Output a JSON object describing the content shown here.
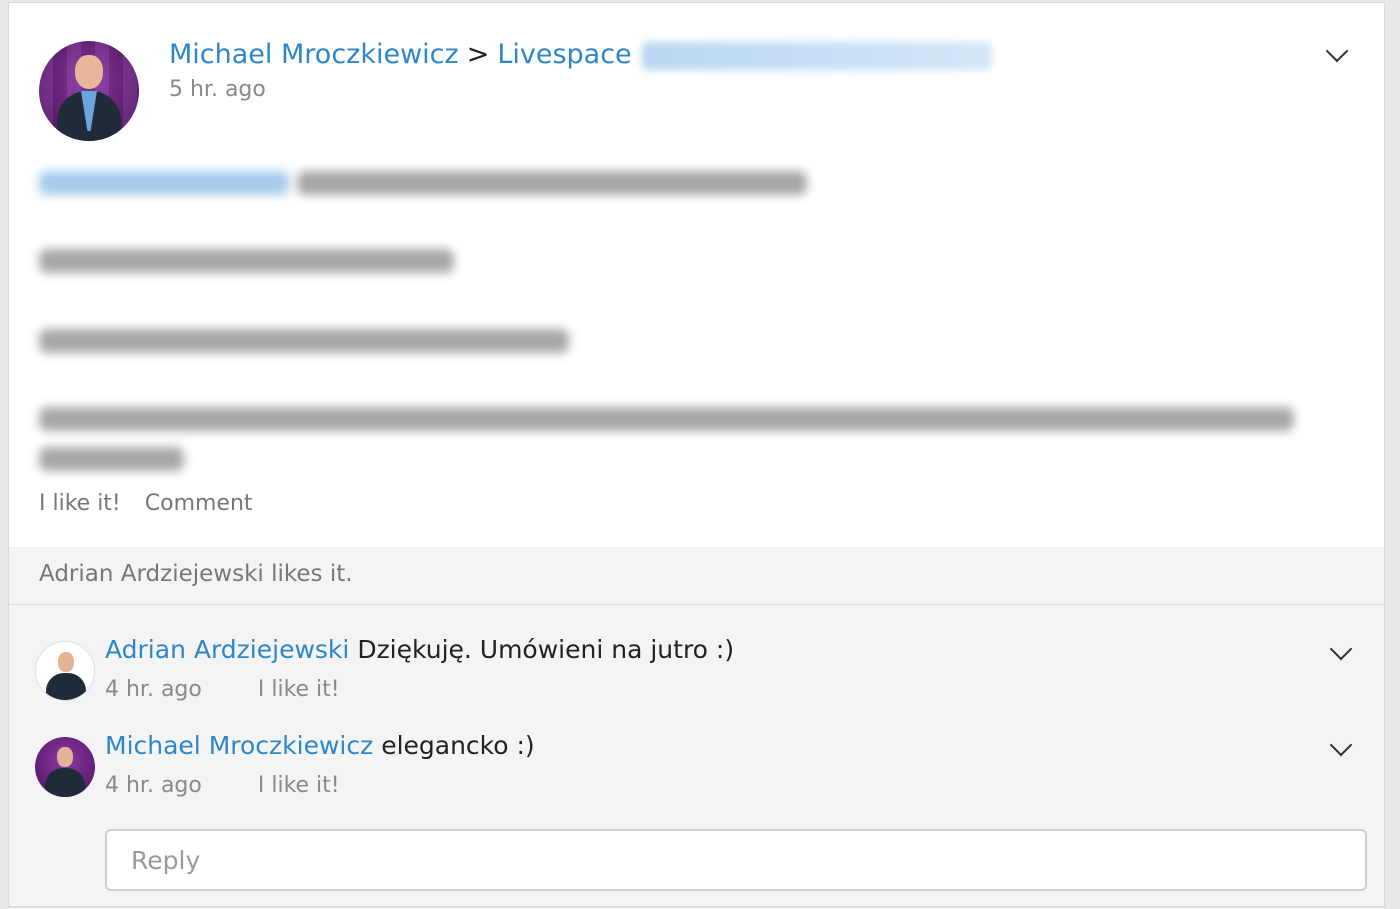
{
  "post": {
    "author": "Michael Mroczkiewicz",
    "separator": ">",
    "target": "Livespace",
    "time": "5 hr. ago",
    "actions": {
      "like": "I like it!",
      "comment": "Comment"
    }
  },
  "likes": {
    "text": "Adrian Ardziejewski likes it."
  },
  "comments": [
    {
      "author": "Adrian Ardziejewski",
      "text": "Dziękuję. Umówieni na jutro :)",
      "time": "4 hr. ago",
      "like": "I like it!"
    },
    {
      "author": "Michael Mroczkiewicz",
      "text": "elegancko :)",
      "time": "4 hr. ago",
      "like": "I like it!"
    }
  ],
  "reply": {
    "placeholder": "Reply"
  },
  "colors": {
    "link": "#2f86c9",
    "muted": "#8a8a8a",
    "panel": "#f4f4f4"
  }
}
